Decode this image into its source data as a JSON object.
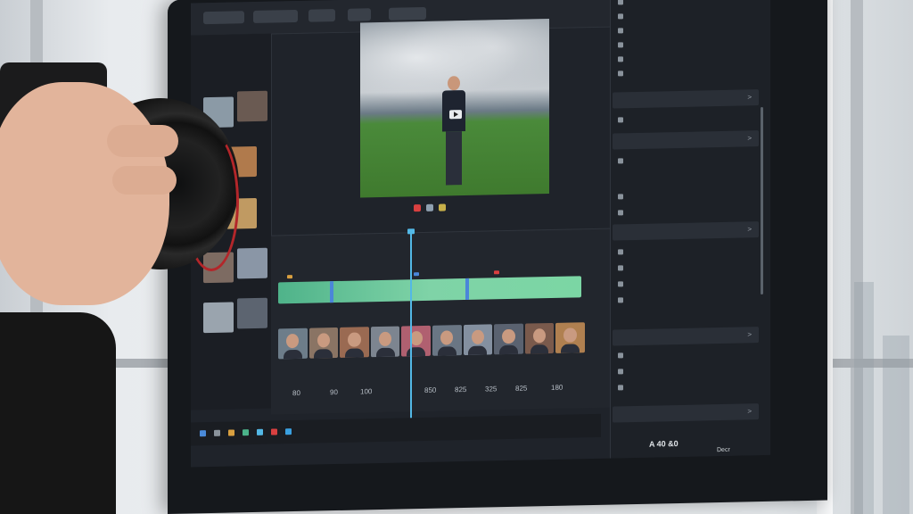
{
  "inspector": {
    "sections": [
      {
        "label": "",
        "chevron": ">"
      },
      {
        "label": "",
        "chevron": ">"
      },
      {
        "label": "",
        "chevron": ">"
      },
      {
        "label": "",
        "chevron": ">"
      },
      {
        "label": "",
        "chevron": ">"
      }
    ]
  },
  "timeline": {
    "ruler": [
      "80",
      "90",
      "100",
      "850",
      "825",
      "325",
      "825",
      "180"
    ]
  },
  "tray": {
    "clock": "A 40 &0",
    "date": "Decr"
  },
  "colors": {
    "accent_track": "#6ccf9d",
    "playhead": "#53b8e6",
    "marker_blue": "#4b86d9",
    "marker_red": "#d94040",
    "camera_ring": "#b3262a"
  }
}
